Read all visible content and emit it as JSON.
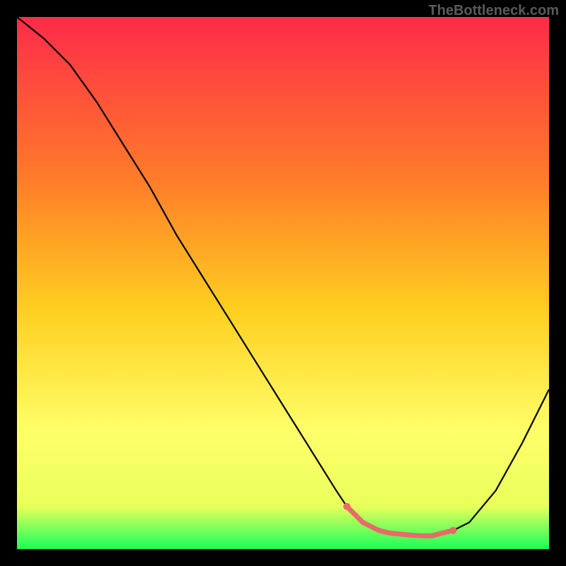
{
  "watermark": "TheBottleneck.com",
  "chart_data": {
    "type": "line",
    "title": "",
    "xlabel": "",
    "ylabel": "",
    "xlim": [
      0,
      100
    ],
    "ylim": [
      0,
      100
    ],
    "background_gradient": {
      "top": "#ff2b4a",
      "mid_upper": "#ff9a1f",
      "mid": "#ffe21f",
      "mid_lower": "#ffff6a",
      "bottom": "#1aff5a"
    },
    "series": [
      {
        "name": "curve",
        "color": "#000000",
        "x": [
          0,
          5,
          10,
          15,
          20,
          25,
          30,
          35,
          40,
          45,
          50,
          55,
          60,
          62,
          65,
          70,
          75,
          78,
          80,
          82,
          85,
          90,
          95,
          100
        ],
        "y": [
          100,
          96,
          91,
          84,
          76,
          68,
          59,
          51,
          43,
          35,
          27,
          19,
          11,
          8,
          5,
          3,
          2.5,
          2.5,
          3,
          3.5,
          5,
          11,
          20,
          30
        ]
      },
      {
        "name": "highlight-band",
        "color": "#e96a6a",
        "x": [
          62,
          65,
          68,
          70,
          72,
          74,
          76,
          78,
          80,
          82
        ],
        "y": [
          8,
          5,
          3.5,
          3,
          2.8,
          2.6,
          2.5,
          2.5,
          3,
          3.5
        ]
      }
    ]
  }
}
